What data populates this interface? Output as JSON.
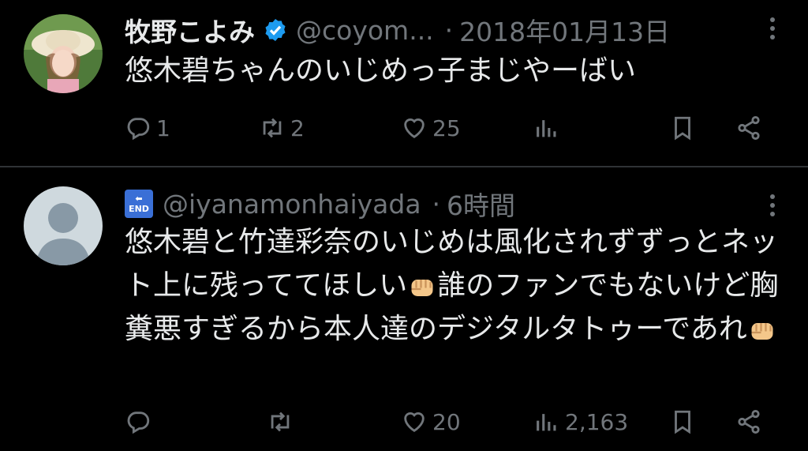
{
  "tweets": [
    {
      "name": "牧野こよみ",
      "handle": "@coyom...",
      "separator": "·",
      "time": "2018年01月13日",
      "text": "悠木碧ちゃんのいじめっ子まじやーばい",
      "actions": {
        "replies": "1",
        "retweets": "2",
        "likes": "25",
        "views": ""
      }
    },
    {
      "name_emoji": "END",
      "handle": "@iyanamonhaiyada",
      "separator": "·",
      "time": "6時間",
      "text_parts": [
        "悠木碧と竹達彩奈のいじめは風化されずずっとネット上に残っててほしい",
        "誰のファンでもないけど胸糞悪すぎるから本人達のデジタルタトゥーであれ"
      ],
      "actions": {
        "replies": "",
        "retweets": "",
        "likes": "20",
        "views": "2,163"
      }
    }
  ],
  "colors": {
    "background": "#000000",
    "text": "#e7e9ea",
    "muted": "#71767b",
    "verified": "#1d9bf0",
    "divider": "#2f3336"
  },
  "icons": [
    "reply-icon",
    "retweet-icon",
    "like-icon",
    "views-icon",
    "bookmark-icon",
    "share-icon",
    "more-icon",
    "verified-icon",
    "fist-emoji",
    "end-arrow-emoji"
  ]
}
